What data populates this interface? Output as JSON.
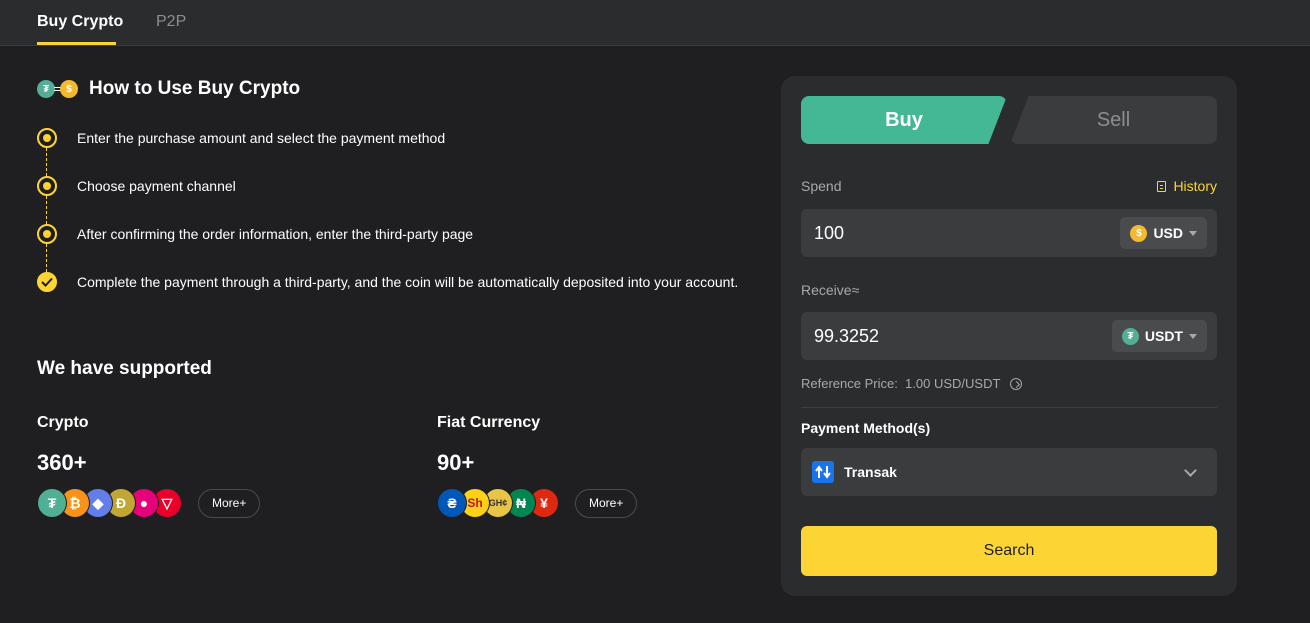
{
  "tabs": [
    {
      "label": "Buy Crypto",
      "active": true
    },
    {
      "label": "P2P",
      "active": false
    }
  ],
  "howto": {
    "title": "How to Use Buy Crypto",
    "steps": [
      "Enter the purchase amount and select the payment method",
      "Choose payment channel",
      "After confirming the order information, enter the third-party page",
      "Complete the payment through a third-party, and the coin will be automatically deposited into your account."
    ]
  },
  "supported": {
    "title": "We have supported",
    "crypto": {
      "label": "Crypto",
      "count": "360+",
      "more": "More+",
      "icons": [
        {
          "name": "tether-icon",
          "glyph": "₮",
          "color": "#50af95"
        },
        {
          "name": "bitcoin-icon",
          "glyph": "₿",
          "color": "#f7931a"
        },
        {
          "name": "ethereum-icon",
          "glyph": "◆",
          "color": "#627eea"
        },
        {
          "name": "dogecoin-icon",
          "glyph": "Ð",
          "color": "#c2a633"
        },
        {
          "name": "polkadot-icon",
          "glyph": "●",
          "color": "#e6007a"
        },
        {
          "name": "tron-icon",
          "glyph": "▽",
          "color": "#eb0029"
        }
      ]
    },
    "fiat": {
      "label": "Fiat Currency",
      "count": "90+",
      "more": "More+",
      "icons": [
        {
          "name": "uah-icon",
          "glyph": "₴",
          "color": "#0057b7"
        },
        {
          "name": "sh-icon",
          "glyph": "Sh",
          "color": "#fcd116"
        },
        {
          "name": "ghc-icon",
          "glyph": "GH¢",
          "color": "#e8c547"
        },
        {
          "name": "ngn-icon",
          "glyph": "₦",
          "color": "#008751"
        },
        {
          "name": "yen-icon",
          "glyph": "¥",
          "color": "#de2910"
        }
      ]
    }
  },
  "trade": {
    "buy_label": "Buy",
    "sell_label": "Sell",
    "history_label": "History",
    "spend": {
      "label": "Spend",
      "value": "100",
      "currency": "USD",
      "icon_glyph": "$",
      "icon_color": "#f3ba2f"
    },
    "receive": {
      "label": "Receive≈",
      "value": "99.3252",
      "currency": "USDT",
      "icon_glyph": "₮",
      "icon_color": "#50af95"
    },
    "reference": "Reference Price:  1.00 USD/USDT",
    "payment_label": "Payment Method(s)",
    "payment_method": "Transak",
    "search_label": "Search"
  },
  "colors": {
    "accent": "#fcd535",
    "buy": "#44b894"
  }
}
